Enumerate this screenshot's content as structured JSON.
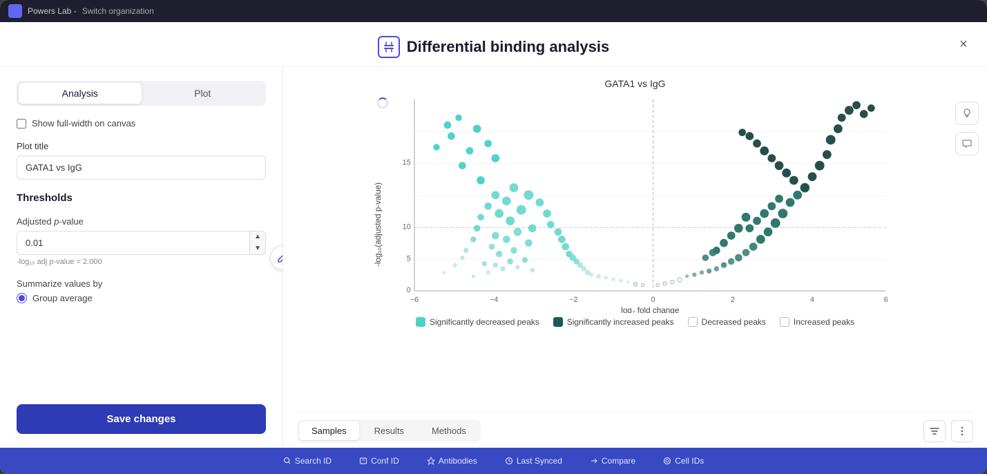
{
  "topbar": {
    "org_label": "Powers Lab -",
    "switch_label": "Switch organization"
  },
  "modal": {
    "title": "Differential binding analysis",
    "close_label": "×"
  },
  "left_panel": {
    "tab_analysis": "Analysis",
    "tab_plot": "Plot",
    "show_fullwidth_label": "Show full-width on canvas",
    "plot_title_label": "Plot title",
    "plot_title_value": "GATA1 vs IgG",
    "thresholds_label": "Thresholds",
    "adjusted_pvalue_label": "Adjusted p-value",
    "pvalue_value": "0.01",
    "pvalue_hint": "-log₁₀ adj p-value = 2.000",
    "summarize_label": "Summarize values by",
    "group_average_label": "Group average",
    "save_btn_label": "Save changes"
  },
  "chart": {
    "title": "GATA1 vs IgG",
    "x_label": "log₂ fold change",
    "y_label": "-log₁₀(adjusted p-value)",
    "loading": true
  },
  "legend": {
    "items": [
      {
        "key": "sig_decreased",
        "color": "filled-teal",
        "label": "Significantly decreased peaks"
      },
      {
        "key": "sig_increased",
        "color": "filled-dark",
        "label": "Significantly increased peaks"
      },
      {
        "key": "decreased",
        "color": "empty",
        "label": "Decreased peaks"
      },
      {
        "key": "increased",
        "color": "empty",
        "label": "Increased peaks"
      }
    ]
  },
  "bottom_tabs": {
    "samples": "Samples",
    "results": "Results",
    "methods": "Methods",
    "active": "Samples"
  },
  "bottom_strip": {
    "items": [
      "Search ID",
      "Conf ID",
      "Antibodies",
      "Last Synced",
      "Compare",
      "Cell IDs"
    ]
  },
  "side_actions": {
    "lightbulb": "💡",
    "chat": "💬"
  }
}
